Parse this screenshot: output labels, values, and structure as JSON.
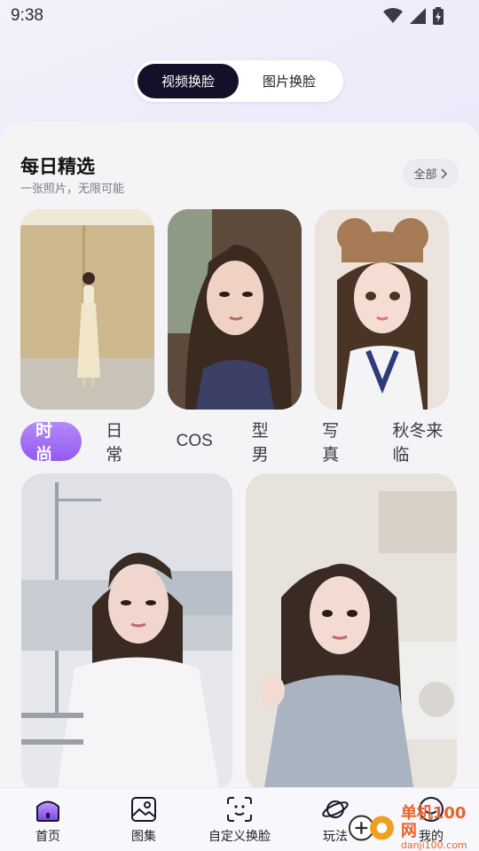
{
  "status_bar": {
    "time": "9:38"
  },
  "segment": {
    "video": "视频换脸",
    "photo": "图片换脸"
  },
  "daily": {
    "title": "每日精选",
    "subtitle": "一张照片，无限可能",
    "all": "全部"
  },
  "tabs": [
    "时尚",
    "日常",
    "COS",
    "型男",
    "写真",
    "秋冬来临"
  ],
  "bottom_nav": {
    "home": "首页",
    "gallery": "图集",
    "custom": "自定义换脸",
    "play": "玩法",
    "mine": "我的"
  },
  "watermark": {
    "cn": "单机100网",
    "url": "danji100.com"
  },
  "colors": {
    "accent": "#9459f2",
    "dark": "#14102a"
  }
}
